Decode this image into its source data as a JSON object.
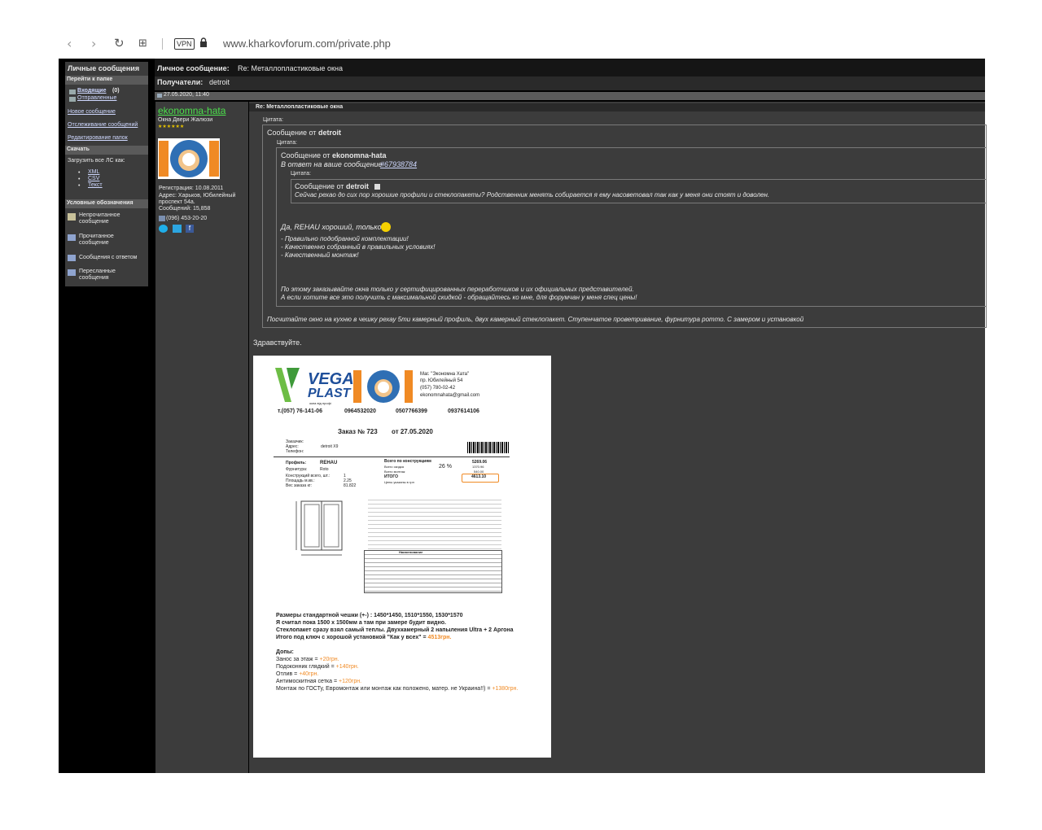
{
  "browser": {
    "url": "www.kharkovforum.com/private.php",
    "vpn_label": "VPN"
  },
  "sidebar": {
    "title": "Личные сообщения",
    "goto_header": "Перейти к папке",
    "inbox": "Входящие",
    "inbox_count": "(0)",
    "sent": "Отправленные",
    "new_message": "Новое сообщение",
    "tracking": "Отслеживание сообщений",
    "edit_folders": "Редактирование папок",
    "download_header": "Скачать",
    "download_all": "Загрузить все ЛС как:",
    "formats": [
      "XML",
      "CSV",
      "Текст"
    ],
    "legend_header": "Условные обозначения",
    "legend": [
      "Непрочитанное сообщение",
      "Прочитанное сообщение",
      "Сообщения с ответом",
      "Пересланные сообщения"
    ]
  },
  "message": {
    "header_label": "Личное сообщение:",
    "header_subject": "Re: Металлопластиковые окна",
    "recipients_label": "Получатели:",
    "recipients": "detroit",
    "date": "27.05.2020, 11:40",
    "subject": "Re: Металлопластиковые окна",
    "quote_label": "Цитата:",
    "quote1_from": "Сообщение от",
    "quote1_author": "detroit",
    "quote2_from": "Сообщение от",
    "quote2_author": "ekonomna-hata",
    "quote2_reply": "В ответ на ваше сообщение",
    "quote2_msgid": "#67938784",
    "quote3_from": "Сообщение от",
    "quote3_author": "detroit",
    "quote3_text": "Сейчас рехао до сих пор хорошие профили и стеклопакеты? Родственник менять собирается я ему насоветовал так как у меня они стоят и доволен.",
    "reply_line1": "Да, REHAU хороший, только",
    "reply_bullets": [
      "- Правильно подобранной комплектации!",
      "- Качественно собранный в правильных условиях!",
      "- Качественный монтаж!"
    ],
    "reply_note1": "По этому заказывайте окна только у сертифицированных переработчиков и их официальных представителей.",
    "reply_note2": "А если хотите все это получить с максимальной скидкой - обращайтесь ко мне, для форумчан у меня спец цены!",
    "quote1_tail": "Посчитайте окно на кухню в чешку рехау 5ти камерный профиль, двух камерный стеклопакет. Ступенчатое проветривание, фурнитура ротто. С замером и установкой",
    "greeting": "Здравствуйте."
  },
  "user": {
    "name": "ekonomna-hata",
    "tagline": "Окна Двери Жалюзи",
    "stars": "★★★★★★",
    "reg": "Регистрация: 10.08.2011",
    "address1": "Адрес: Харьков, Юбилейный",
    "address2": "проспект 54а.",
    "posts": "Сообщений: 15,858",
    "phone": "(096) 453-20-20",
    "logo_text_left": "ОКНА",
    "logo_text_right": "ДВЕРИ",
    "logo_text_top": "ЕКОНОМНА",
    "logo_text_bottom": "ХАТА"
  },
  "invoice": {
    "brand1": "VEGA",
    "brand2": "PLAST",
    "brand_small": "окна від профі",
    "shop_name": "Маг. \"Экономна Хата\"",
    "shop_addr": "пр. Юбилейный 54",
    "shop_phone": "(057) 780-02-42",
    "shop_email": "ekonomnahata@gmail.com",
    "phones": [
      "т.(057) 76-141-06",
      "0964532020",
      "0507766399",
      "0937614106"
    ],
    "order": "Заказ № 723",
    "order_date": "от 27.05.2020",
    "client_labels": [
      "Заказчик:",
      "Адрес:",
      "Телефон:"
    ],
    "client_value": "detroit X9",
    "profile_labels": [
      "Профиль:",
      "Фурнитура:",
      "Конструкций всего, шт.:",
      "Площадь м.кв.:",
      "Вес заказа кг:"
    ],
    "profile_values": [
      "REHAU",
      "Roto",
      "1",
      "2.25",
      "81.822"
    ],
    "sum_labels": [
      "Всего по конструкциям",
      "Всего скидка",
      "Всего монтаж",
      "ИТОГО",
      "Цены указаны в грн"
    ],
    "discount": "26 %",
    "sum_values": [
      "5269.06",
      "1370.96",
      "540.00",
      "4613.10"
    ],
    "spec_title": "Наименование",
    "summary_lines": [
      "Размеры стандартной чешки (+-) : 1450*1450, 1510*1550, 1530*1570",
      "Я считал пока 1500 х 1500мм а там при замере будит видно.",
      "Стеклопакет сразу взял самый теплы. Двухкамерный 2 напыления Ultra + 2 Аргона"
    ],
    "total_line": "Итого под ключ с хорошой установкой \"Как у всех\" =",
    "total_value": "4513грн.",
    "extras_title": "Допы:",
    "extras": [
      {
        "label": "Занос за этаж =",
        "value": "+20грн."
      },
      {
        "label": "Подоконник глядкий =",
        "value": "+140грн."
      },
      {
        "label": "Отлив =",
        "value": "+40грн."
      },
      {
        "label": "Антимоскитная сетка =",
        "value": "+120грн."
      },
      {
        "label": "Монтаж по ГОСТу, Евромонтаж или монтаж как положено, матер. не Украина!!) =",
        "value": "+1380грн."
      }
    ]
  }
}
